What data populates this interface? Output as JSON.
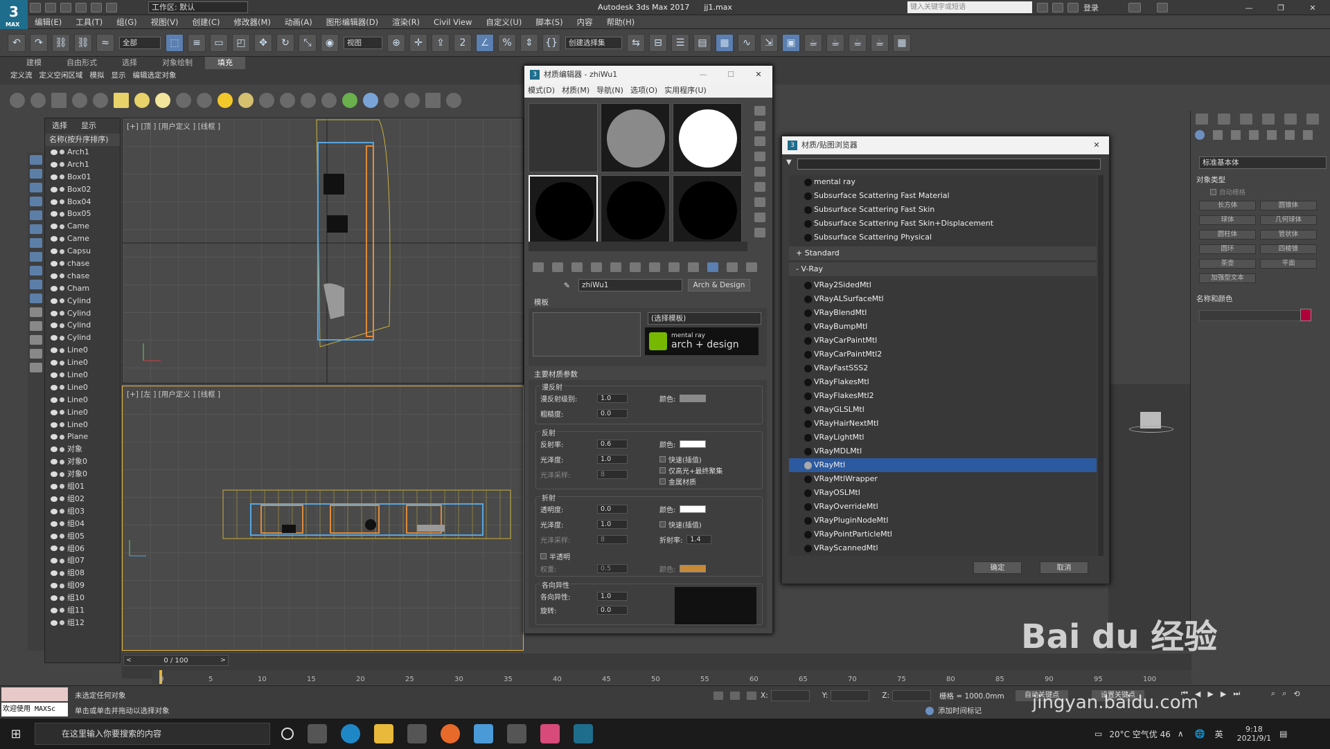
{
  "window": {
    "app_title": "Autodesk 3ds Max 2017",
    "file_name": "jj1.max",
    "workspace": "工作区: 默认",
    "search_placeholder": "键入关键字或短语",
    "login": "登录"
  },
  "menus": [
    "编辑(E)",
    "工具(T)",
    "组(G)",
    "视图(V)",
    "创建(C)",
    "修改器(M)",
    "动画(A)",
    "图形编辑器(D)",
    "渲染(R)",
    "Civil View",
    "自定义(U)",
    "脚本(S)",
    "内容",
    "帮助(H)"
  ],
  "toolbar": {
    "filter": "全部",
    "view": "视图",
    "selection_set": "创建选择集"
  },
  "ribbon": {
    "tabs": [
      "建模",
      "自由形式",
      "选择",
      "对象绘制",
      "填充"
    ],
    "sub": [
      "定义流",
      "定义空闲区域",
      "模拟",
      "显示",
      "编辑选定对象"
    ]
  },
  "scene_explorer": {
    "tabs": [
      "选择",
      "显示"
    ],
    "header": "名称(按升序排序)",
    "items": [
      "Arch1",
      "Arch1",
      "Box01",
      "Box02",
      "Box04",
      "Box05",
      "Came",
      "Came",
      "Capsu",
      "chase",
      "chase",
      "Cham",
      "Cylind",
      "Cylind",
      "Cylind",
      "Cylind",
      "Line0",
      "Line0",
      "Line0",
      "Line0",
      "Line0",
      "Line0",
      "Line0",
      "Plane",
      "对象",
      "对象0",
      "对象0",
      "组01",
      "组02",
      "组03",
      "组04",
      "组05",
      "组06",
      "组07",
      "组08",
      "组09",
      "组10",
      "组11",
      "组12"
    ]
  },
  "viewports": {
    "top": "[+] [顶 ] [用户定义 ] [线框 ]",
    "left": "[+] [左 ] [用户定义 ] [线框 ]"
  },
  "material_editor": {
    "title": "材质编辑器 - zhiWu1",
    "menu": [
      "模式(D)",
      "材质(M)",
      "导航(N)",
      "选项(O)",
      "实用程序(U)"
    ],
    "material_name": "zhiWu1",
    "material_type": "Arch & Design",
    "template_section": "模板",
    "template_select": "(选择模板)",
    "badge_line1": "mental ray",
    "badge_line2": "arch + design",
    "main_section": "主要材质参数",
    "diffuse": {
      "group": "漫反射",
      "level_label": "漫反射级别:",
      "level": "1.0",
      "roughness_label": "粗糙度:",
      "roughness": "0.0",
      "color_label": "颜色:",
      "color": "#8a8a8a"
    },
    "reflection": {
      "group": "反射",
      "refl_label": "反射率:",
      "refl": "0.6",
      "gloss_label": "光泽度:",
      "gloss": "1.0",
      "samples_label": "光泽采样:",
      "samples": "8",
      "color_label": "颜色:",
      "color": "#ffffff",
      "fast_interp": "快速(插值)",
      "highlight_fg": "仅高光+最终聚集",
      "metal": "金属材质"
    },
    "refraction": {
      "group": "折射",
      "transp_label": "透明度:",
      "transp": "0.0",
      "gloss_label": "光泽度:",
      "gloss": "1.0",
      "samples_label": "光泽采样:",
      "samples": "8",
      "color_label": "颜色:",
      "color": "#ffffff",
      "fast_interp": "快速(插值)",
      "ior_label": "折射率:",
      "ior": "1.4"
    },
    "translucency": {
      "label": "半透明",
      "weight_label": "权重:",
      "weight": "0.5",
      "color_label": "颜色:",
      "color": "#c68a3a"
    },
    "anisotropy": {
      "group": "各向异性",
      "aniso_label": "各向异性:",
      "aniso": "1.0",
      "rotation_label": "旋转:",
      "rotation": "0.0"
    }
  },
  "browser": {
    "title": "材质/贴图浏览器",
    "items": [
      {
        "label": "mental ray",
        "kind": "item"
      },
      {
        "label": "Subsurface Scattering Fast Material",
        "kind": "item"
      },
      {
        "label": "Subsurface Scattering Fast Skin",
        "kind": "item"
      },
      {
        "label": "Subsurface Scattering Fast Skin+Displacement",
        "kind": "item"
      },
      {
        "label": "Subsurface Scattering Physical",
        "kind": "item"
      },
      {
        "label": "+ Standard",
        "kind": "hdr"
      },
      {
        "label": "- V-Ray",
        "kind": "hdr"
      },
      {
        "label": "VRay2SidedMtl",
        "kind": "item"
      },
      {
        "label": "VRayALSurfaceMtl",
        "kind": "item"
      },
      {
        "label": "VRayBlendMtl",
        "kind": "item"
      },
      {
        "label": "VRayBumpMtl",
        "kind": "item"
      },
      {
        "label": "VRayCarPaintMtl",
        "kind": "item"
      },
      {
        "label": "VRayCarPaintMtl2",
        "kind": "item"
      },
      {
        "label": "VRayFastSSS2",
        "kind": "item"
      },
      {
        "label": "VRayFlakesMtl",
        "kind": "item"
      },
      {
        "label": "VRayFlakesMtl2",
        "kind": "item"
      },
      {
        "label": "VRayGLSLMtl",
        "kind": "item"
      },
      {
        "label": "VRayHairNextMtl",
        "kind": "item"
      },
      {
        "label": "VRayLightMtl",
        "kind": "item"
      },
      {
        "label": "VRayMDLMtl",
        "kind": "item"
      },
      {
        "label": "VRayMtl",
        "kind": "sel"
      },
      {
        "label": "VRayMtlWrapper",
        "kind": "item"
      },
      {
        "label": "VRayOSLMtl",
        "kind": "item"
      },
      {
        "label": "VRayOverrideMtl",
        "kind": "item"
      },
      {
        "label": "VRayPluginNodeMtl",
        "kind": "item"
      },
      {
        "label": "VRayPointParticleMtl",
        "kind": "item"
      },
      {
        "label": "VRayScannedMtl",
        "kind": "item"
      }
    ],
    "ok": "确定",
    "cancel": "取消"
  },
  "command_panel": {
    "dropdown": "标准基本体",
    "section1": "对象类型",
    "autogrid": "自动栅格",
    "buttons": [
      "长方体",
      "圆锥体",
      "球体",
      "几何球体",
      "圆柱体",
      "管状体",
      "圆环",
      "四棱锥",
      "茶壶",
      "平面",
      "加强型文本"
    ],
    "section2": "名称和颜色",
    "swatch": "#b0003a"
  },
  "timeline": {
    "frame": "0 / 100",
    "ticks": [
      "0",
      "5",
      "10",
      "15",
      "20",
      "25",
      "30",
      "35",
      "40",
      "45",
      "50",
      "55",
      "60",
      "65",
      "70",
      "75",
      "80",
      "85",
      "90",
      "95",
      "100"
    ]
  },
  "status": {
    "welcome": "欢迎使用 MAXSc",
    "line1": "未选定任何对象",
    "line2": "单击或单击并拖动以选择对象",
    "x_label": "X:",
    "y_label": "Y:",
    "z_label": "Z:",
    "grid": "栅格 = 1000.0mm",
    "add_time_tag": "添加时间标记",
    "auto_key": "自动关键点",
    "set_key": "设置关键点"
  },
  "taskbar": {
    "search": "在这里输入你要搜索的内容",
    "weather": "20°C 空气优 46",
    "ime": "英",
    "time": "9:18",
    "date": "2021/9/1"
  },
  "watermark": "jingyan.baidu.com"
}
